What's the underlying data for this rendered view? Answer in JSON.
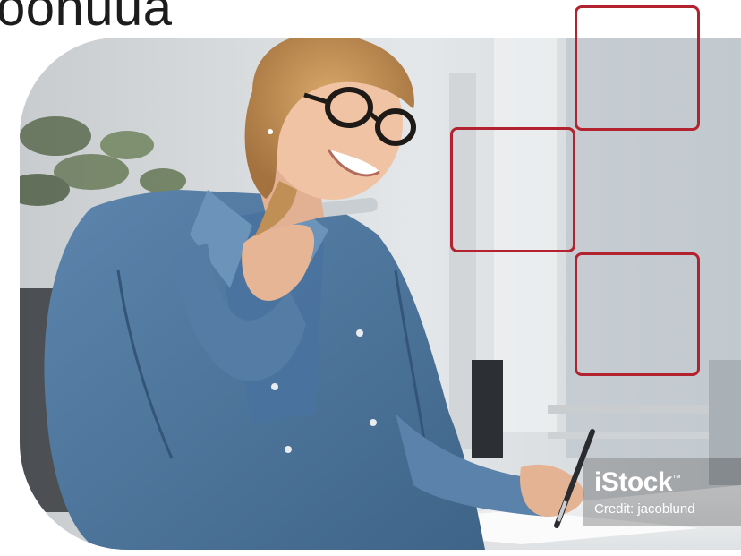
{
  "heading": {
    "partial_text": "oonuua"
  },
  "photo": {
    "accent_color": "#b3232f",
    "watermark": {
      "logo": "iStock",
      "trademark": "™",
      "credit": "Credit: jacoblund"
    }
  }
}
